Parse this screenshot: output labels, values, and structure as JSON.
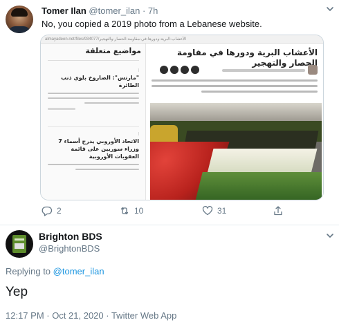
{
  "tweet1": {
    "author_name": "Tomer Ilan",
    "author_handle": "@tomer_ilan",
    "separator": "·",
    "time": "7h",
    "text": "No, you copied a 2019 photo from a Lebanese website.",
    "media": {
      "url_text": "almayadeen.net/files/934077/الأعشاب-البرية-ودورها-في-مقاومة-الحصار-والتهجير",
      "article_title": "الأعشاب البرية ودورها في مقاومة الحصار والتهجير",
      "sidebar_title": "مواضيع متعلقة",
      "card1_title": "\"مارتس\": الصاروخ بلوي ذنب الطائرة",
      "card2_title": "الاتحاد الأوروبي يدرج أسماء 7 وزراء سوريين على قائمة العقوبات الأوروبية"
    },
    "actions": {
      "replies": "2",
      "retweets": "10",
      "likes": "31"
    },
    "icons": {
      "reply": "reply-icon",
      "retweet": "retweet-icon",
      "like": "heart-icon",
      "share": "share-icon",
      "more": "chevron-down-icon"
    }
  },
  "tweet2": {
    "author_name": "Brighton BDS",
    "author_handle": "@BrightonBDS",
    "replying_label": "Replying to",
    "replying_to": "@tomer_ilan",
    "text": "Yep",
    "timestamp": "12:17 PM · Oct 21, 2020 · Twitter Web App"
  },
  "colors": {
    "link": "#1b95e0",
    "secondary_text": "#657786",
    "primary_text": "#14171a",
    "divider": "#e6ecf0"
  }
}
